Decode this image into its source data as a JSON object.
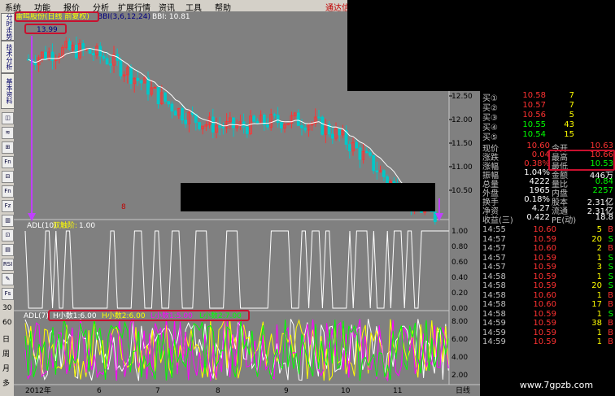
{
  "menu": [
    "系统",
    "功能",
    "报价",
    "分析",
    "扩展行情",
    "资讯",
    "工具",
    "帮助"
  ],
  "menu_right": "通达信",
  "sidebar": {
    "tabs": [
      "分时走势",
      "技术分析",
      "基本资料"
    ],
    "buttons": [
      "◫",
      "≋",
      "⊞",
      "Fn",
      "⊟",
      "Fn",
      "Fz",
      "▥",
      "⊡",
      "▤",
      "RSI",
      "✎",
      "Fs"
    ],
    "periods": [
      "30",
      "60",
      "日",
      "周",
      "月",
      "多"
    ]
  },
  "main_chart": {
    "title": "雷鸣股份(日线 前复权)",
    "indicator": "BBI(3,6,12,24)",
    "bbi_value": "BBI: 10.81",
    "high_marker": "13.99",
    "low_marker": "8",
    "y_ticks": [
      "12.50",
      "12.00",
      "11.50",
      "11.00",
      "10.50"
    ]
  },
  "panel2": {
    "indicator": "ADL(10)",
    "param_label": "双触阶:",
    "param_value": "1.00",
    "y_ticks": [
      "1.00",
      "0.80",
      "0.60",
      "0.40",
      "0.20",
      "0.00"
    ]
  },
  "panel3": {
    "indicator": "ADL(7)",
    "params": [
      {
        "label": "H小数1:",
        "value": "6.00",
        "color": "#ffffff"
      },
      {
        "label": "H小数2:",
        "value": "6.00",
        "color": "#ffff00"
      },
      {
        "label": "L小数1:",
        "value": "5.00",
        "color": "#ff00ff"
      },
      {
        "label": "L小数2:",
        "value": "7.00",
        "color": "#00ff00"
      }
    ],
    "y_ticks": [
      "8.00",
      "6.00",
      "4.00",
      "2.00"
    ]
  },
  "time_axis": [
    "2012年",
    "6",
    "7",
    "8",
    "9",
    "10",
    "11"
  ],
  "time_axis_right": "日线",
  "quotes": {
    "order_book": [
      {
        "label": "买①",
        "price": "10.58",
        "vol": "7"
      },
      {
        "label": "买②",
        "price": "10.57",
        "vol": "7"
      },
      {
        "label": "买③",
        "price": "10.56",
        "vol": "5"
      },
      {
        "label": "买④",
        "price": "10.55",
        "vol": "43"
      },
      {
        "label": "买⑤",
        "price": "10.54",
        "vol": "15"
      }
    ],
    "stats": [
      {
        "l1": "现价",
        "v1": "10.60",
        "l2": "今开",
        "v2": "10.63"
      },
      {
        "l1": "涨跌",
        "v1": "0.04",
        "l2": "最高",
        "v2": "10.66"
      },
      {
        "l1": "涨幅",
        "v1": "0.38%",
        "l2": "最低",
        "v2": "10.53"
      },
      {
        "l1": "振幅",
        "v1": "1.04%",
        "l2": "金额",
        "v2": "446万"
      },
      {
        "l1": "总量",
        "v1": "4222",
        "l2": "量比",
        "v2": "0.84"
      },
      {
        "l1": "外盘",
        "v1": "1965",
        "l2": "内盘",
        "v2": "2257"
      },
      {
        "l1": "换手",
        "v1": "0.18%",
        "l2": "股本",
        "v2": "2.31亿"
      },
      {
        "l1": "净资",
        "v1": "4.27",
        "l2": "流通",
        "v2": "2.31亿"
      },
      {
        "l1": "收益(三)",
        "v1": "0.422",
        "l2": "PE(动)",
        "v2": "18.8"
      }
    ],
    "ticks": [
      {
        "time": "14:55",
        "price": "10.60",
        "vol": "5",
        "side": "B"
      },
      {
        "time": "14:57",
        "price": "10.59",
        "vol": "20",
        "side": "S"
      },
      {
        "time": "14:57",
        "price": "10.60",
        "vol": "2",
        "side": "B"
      },
      {
        "time": "14:57",
        "price": "10.59",
        "vol": "1",
        "side": "S"
      },
      {
        "time": "14:57",
        "price": "10.59",
        "vol": "3",
        "side": "S"
      },
      {
        "time": "14:58",
        "price": "10.59",
        "vol": "1",
        "side": "S"
      },
      {
        "time": "14:58",
        "price": "10.59",
        "vol": "20",
        "side": "S"
      },
      {
        "time": "14:58",
        "price": "10.60",
        "vol": "1",
        "side": "B"
      },
      {
        "time": "14:58",
        "price": "10.60",
        "vol": "17",
        "side": "B"
      },
      {
        "time": "14:58",
        "price": "10.59",
        "vol": "1",
        "side": "S"
      },
      {
        "time": "14:59",
        "price": "10.59",
        "vol": "38",
        "side": "B"
      },
      {
        "time": "14:59",
        "price": "10.59",
        "vol": "1",
        "side": "B"
      },
      {
        "time": "14:59",
        "price": "10.59",
        "vol": "1",
        "side": "B"
      }
    ]
  },
  "watermark": "www.7gpzb.com",
  "colors": {
    "up": "#ff3232",
    "down": "#00c8c8",
    "green": "#00ff00",
    "label": "#ffff00",
    "frame": "#c8102e"
  }
}
